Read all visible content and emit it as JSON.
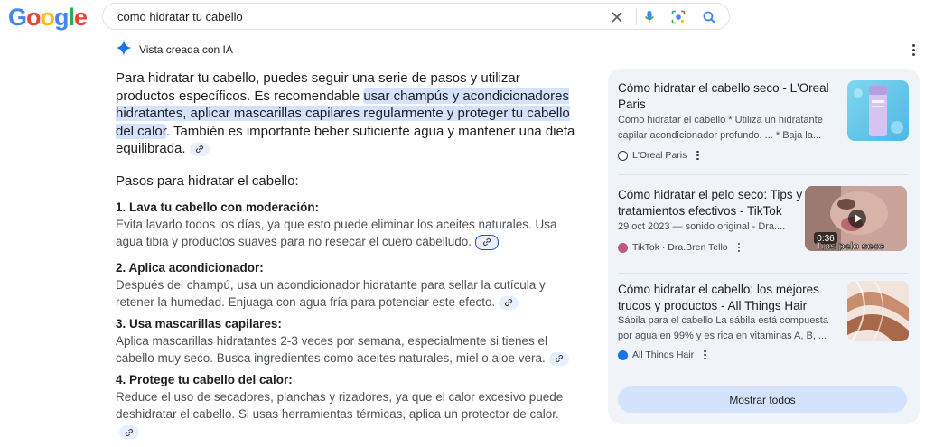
{
  "logo": {
    "letters": [
      "G",
      "o",
      "o",
      "g",
      "l",
      "e"
    ],
    "colors": [
      "#4285f4",
      "#ea4335",
      "#fbbc05",
      "#4285f4",
      "#34a853",
      "#ea4335"
    ]
  },
  "search": {
    "query": "como hidratar tu cabello",
    "icons": [
      "clear-icon",
      "microphone-icon",
      "lens-icon",
      "search-icon"
    ]
  },
  "ai": {
    "label": "Vista creada con IA",
    "icon": "sparkle-icon",
    "accent": "#1a73e8"
  },
  "intro": {
    "before": "Para hidratar tu cabello, puedes seguir una serie de pasos y utilizar productos específicos. Es recomendable ",
    "highlight": "usar champús y acondicionadores hidratantes, aplicar mascarillas capilares regularmente y proteger tu cabello del calor",
    "after": ". También es importante beber suficiente agua y mantener una dieta equilibrada."
  },
  "steps_title": "Pasos para hidratar el cabello:",
  "steps": [
    {
      "title": "1. Lava tu cabello con moderación:",
      "text": "Evita lavarlo todos los días, ya que esto puede eliminar los aceites naturales. Usa agua tibia y productos suaves para no resecar el cuero cabelludo."
    },
    {
      "title": "2. Aplica acondicionador:",
      "text": "Después del champú, usa un acondicionador hidratante para sellar la cutícula y retener la humedad. Enjuaga con agua fría para potenciar este efecto."
    },
    {
      "title": "3. Usa mascarillas capilares:",
      "text": "Aplica mascarillas hidratantes 2-3 veces por semana, especialmente si tienes el cabello muy seco. Busca ingredientes como aceites naturales, miel o aloe vera."
    },
    {
      "title": "4. Protege tu cabello del calor:",
      "text": "Reduce el uso de secadores, planchas y rizadores, ya que el calor excesivo puede deshidratar el cabello. Si usas herramientas térmicas, aplica un protector de calor."
    }
  ],
  "sources": [
    {
      "title": "Cómo hidratar el cabello seco - L'Oreal Paris",
      "snippet": "Cómo hidratar el cabello * Utiliza un hidratante capilar acondicionador profundo. ... * Baja la...",
      "source": "L'Oreal Paris",
      "thumb_label": ""
    },
    {
      "title": "Cómo hidratar el pelo seco: Tips y tratamientos efectivos - TikTok",
      "snippet": "29 oct 2023 — sonido original - Dra....",
      "source": "TikTok · Dra.Bren Tello",
      "thumb_label": "Tips pelo seco",
      "duration": "0:36"
    },
    {
      "title": "Cómo hidratar el cabello: los mejores trucos y productos - All Things Hair",
      "snippet": "Sábila para el cabello La sábila está compuesta por agua en 99% y es rica en vitaminas A, B, ...",
      "source": "All Things Hair",
      "thumb_label": ""
    }
  ],
  "show_all": "Mostrar todos"
}
